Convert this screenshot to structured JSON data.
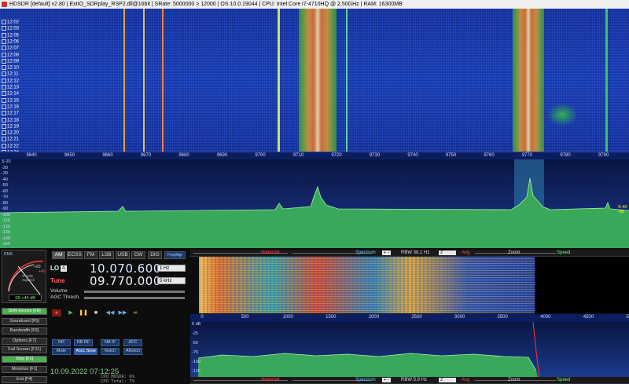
{
  "titlebar": {
    "text": "HDSDR [default] v2.80 | ExtIO_SDRplay_RSP2.dll@16bit | SRate: 5000000 > 12000 | OS 10.0.19044 | CPU: Intel Core i7-4710HQ @ 2.50GHz | RAM: 16300MB"
  },
  "waterfall": {
    "times": [
      "12:02",
      "12:03",
      "12:05",
      "12:06",
      "12:07",
      "12:08",
      "12:09",
      "12:10",
      "12:11",
      "12:12",
      "12:13",
      "12:14",
      "12:15",
      "12:16",
      "12:17",
      "12:18",
      "12:19",
      "12:20",
      "12:21",
      "12:22",
      "12:24"
    ]
  },
  "scale_top": {
    "ticks": [
      "9640",
      "9650",
      "9660",
      "9670",
      "9680",
      "9690",
      "9700",
      "9710",
      "9720",
      "9730",
      "9740",
      "9750",
      "9760",
      "9770",
      "9780",
      "9790"
    ]
  },
  "spectrum_top": {
    "db_labels": [
      "S-10",
      "-20",
      "-30",
      "-40",
      "-50",
      "-60",
      "-70",
      "-80",
      "-90",
      "-100",
      "-110",
      "-120",
      "-130",
      "-140",
      "-150"
    ],
    "right_label": "S-40\n-85"
  },
  "smeter": {
    "rms": "RMS",
    "label": "S-units\nSquelch",
    "reading": "S5 +44 dB",
    "scale_20": "+20",
    "scale_40": "+40"
  },
  "modes": [
    "AM",
    "ECSS",
    "FM",
    "LSB",
    "USB",
    "CW",
    "DIG"
  ],
  "freqmgr": "FreqMgr",
  "lo": {
    "label": "LO",
    "tag": "A",
    "freq": "10.070.600",
    "step": "1 Hz"
  },
  "tune": {
    "label": "Tune",
    "freq": "09.770.000",
    "step": "5 kHz"
  },
  "volume_label": "Volume",
  "agc_label": "AGC Thresh.",
  "left_buttons": [
    {
      "label": "SDR-Device [F8]",
      "green": true
    },
    {
      "label": "Soundcard [F5]",
      "green": false
    },
    {
      "label": "Bandwidth [F6]",
      "green": false
    },
    {
      "label": "Options [F7]",
      "green": false
    },
    {
      "label": "Full Screen [F11]",
      "green": false
    },
    {
      "label": "Stop [F2]",
      "green": true
    },
    {
      "label": "Minimize [F1]",
      "green": false
    },
    {
      "label": "Exit [F4]",
      "green": false
    }
  ],
  "dsp_row1": [
    "NR",
    "NB RF",
    "NB IF",
    "AFC"
  ],
  "dsp_row2": [
    "Mute",
    "AGC Slow",
    "Notch",
    "ANotch"
  ],
  "datetime": "10.09.2022 07:12:25",
  "cpu": {
    "hdsdr": "CPU HDSDR: 6%",
    "total": "CPU Total: 7%"
  },
  "bar_top": {
    "waterfall": "Waterfall",
    "spectrum": "Spectrum",
    "rbw": "RBW 38.1 Hz",
    "rbw_sel": "2",
    "avg": "Avg",
    "zoom": "Zoom",
    "speed": "Speed"
  },
  "bar_bottom": {
    "waterfall": "Waterfall",
    "spectrum": "Spectrum",
    "rbw": "RBW 5.9 Hz",
    "rbw_sel": "2",
    "avg": "Avg",
    "zoom": "Zoom",
    "speed": "Speed"
  },
  "scale_lower": {
    "ticks": [
      "0",
      "500",
      "1000",
      "1500",
      "2000",
      "2500",
      "3000",
      "3500",
      "4000",
      "4500",
      "5000"
    ]
  },
  "spectrum_lower": {
    "db_labels": [
      "0 dB",
      "-25",
      "-50",
      "-75",
      "-100",
      "-125"
    ]
  },
  "colors": {
    "waterfall_bg": "#1f46c0",
    "spectrum_fill": "#3aa85a",
    "active_green": "#4caf50",
    "tune_red": "#ff6666"
  }
}
